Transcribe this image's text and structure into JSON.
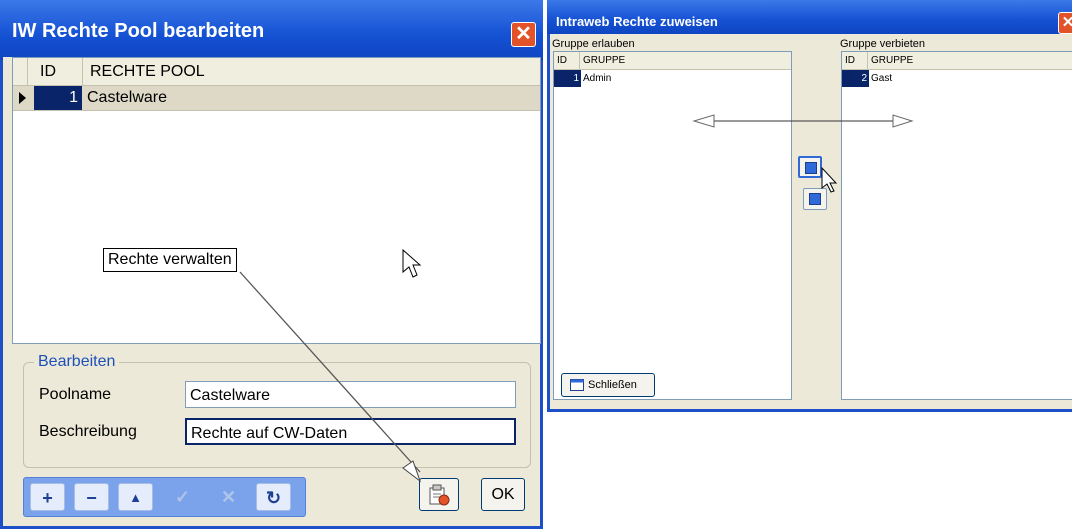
{
  "win1": {
    "title": "IW Rechte Pool bearbeiten",
    "grid": {
      "columns": [
        "ID",
        "RECHTE POOL"
      ],
      "rows": [
        {
          "id": "1",
          "name": "Castelware"
        }
      ]
    },
    "group_label": "Bearbeiten",
    "poolname_label": "Poolname",
    "poolname_value": "Castelware",
    "beschreibung_label": "Beschreibung",
    "beschreibung_value": "Rechte auf CW-Daten",
    "nav": [
      "+",
      "−",
      "▲",
      "✓",
      "✕",
      "↻"
    ],
    "ok_label": "OK",
    "callout": "Rechte verwalten"
  },
  "win2": {
    "title": "Intraweb Rechte zuweisen",
    "left_label": "Gruppe erlauben",
    "right_label": "Gruppe verbieten",
    "columns": [
      "ID",
      "GRUPPE"
    ],
    "left_rows": [
      {
        "id": "1",
        "name": "Admin"
      }
    ],
    "right_rows": [
      {
        "id": "2",
        "name": "Gast"
      }
    ],
    "close_label": "Schließen"
  },
  "colors": {
    "titlebar": "#1451d3",
    "selection": "#0a246a",
    "close": "#e2532a",
    "dialog": "#ece9d8"
  },
  "icons": [
    "close-icon",
    "row-indicator-icon",
    "add-icon",
    "delete-icon",
    "up-icon",
    "confirm-icon",
    "cancel-icon",
    "refresh-icon",
    "rights-icon",
    "move-left-icon",
    "move-right-icon",
    "window-icon",
    "mouse-cursor-icon"
  ]
}
